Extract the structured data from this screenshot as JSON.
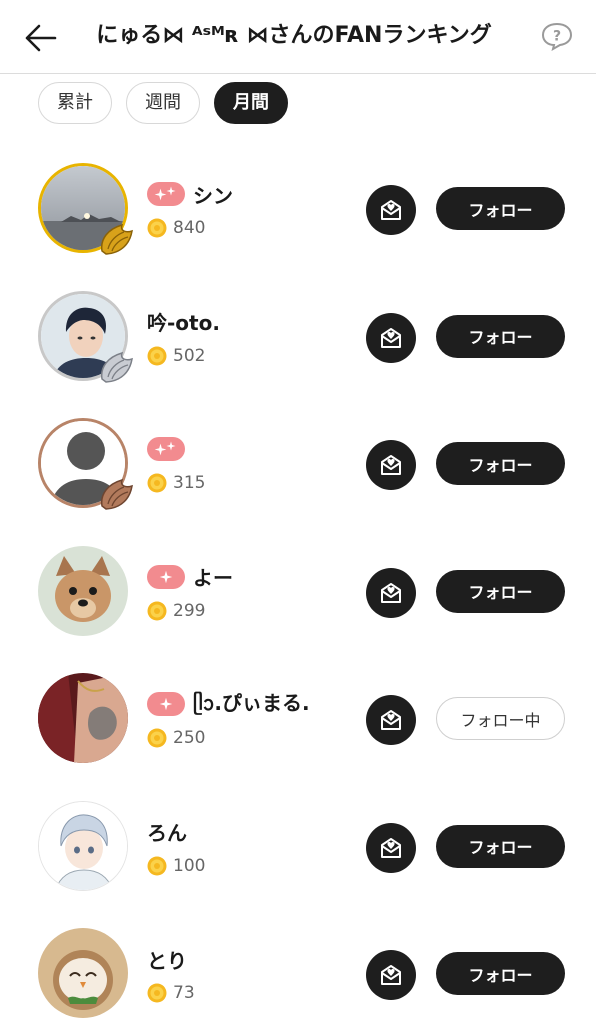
{
  "header": {
    "title": "にゅる⋈ ᴬˢᴹʀ ⋈さんのFANランキング",
    "back_icon": "arrow-left-icon",
    "help_icon": "question-bubble-icon"
  },
  "tabs": [
    {
      "label": "累計",
      "active": false
    },
    {
      "label": "週間",
      "active": false
    },
    {
      "label": "月間",
      "active": true
    }
  ],
  "colors": {
    "dark": "#1e1e1e",
    "badge": "#f28b8f",
    "coin": "#f5b820",
    "gold_ring": "#e8b400"
  },
  "fans": [
    {
      "name": "シン",
      "points": "840",
      "badge_icon": "double-sparkle-icon",
      "avatar": "landscape-photo",
      "rank_icon": "gold-wing-icon",
      "follow_label": "フォロー"
    },
    {
      "name": "吟-oto.",
      "points": "502",
      "badge_icon": "",
      "avatar": "anime-man-portrait",
      "rank_icon": "silver-wing-icon",
      "follow_label": "フォロー"
    },
    {
      "name": "",
      "points": "315",
      "badge_icon": "double-sparkle-icon",
      "avatar": "default-user-silhouette",
      "rank_icon": "bronze-wing-icon",
      "follow_label": "フォロー"
    },
    {
      "name": "よー",
      "points": "299",
      "badge_icon": "single-sparkle-icon",
      "avatar": "dog-photo",
      "rank_icon": "",
      "follow_label": "フォロー"
    },
    {
      "name": "ᥫᩣ.ぴぃまる.",
      "points": "250",
      "badge_icon": "single-sparkle-icon",
      "avatar": "tattoo-photo",
      "rank_icon": "",
      "follow_label": "フォロー中"
    },
    {
      "name": "ろん",
      "points": "100",
      "badge_icon": "",
      "avatar": "anime-boy-illustration",
      "rank_icon": "",
      "follow_label": "フォロー"
    },
    {
      "name": "とり",
      "points": "73",
      "badge_icon": "",
      "avatar": "owl-illustration",
      "rank_icon": "",
      "follow_label": "フォロー"
    }
  ]
}
